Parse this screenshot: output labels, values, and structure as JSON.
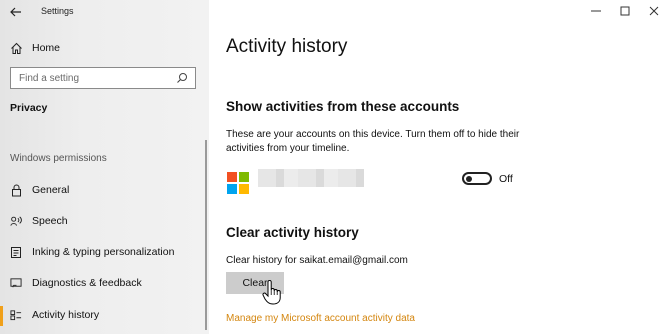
{
  "window": {
    "app_title": "Settings",
    "controls": {
      "minimize": "—",
      "maximize": "☐",
      "close": "✕"
    }
  },
  "sidebar": {
    "home_label": "Home",
    "search": {
      "placeholder": "Find a setting",
      "value": ""
    },
    "section_header": "Privacy",
    "group_label": "Windows permissions",
    "items": [
      {
        "label": "General",
        "icon": "lock-icon"
      },
      {
        "label": "Speech",
        "icon": "speech-icon"
      },
      {
        "label": "Inking & typing personalization",
        "icon": "inking-icon"
      },
      {
        "label": "Diagnostics & feedback",
        "icon": "diagnostics-icon"
      },
      {
        "label": "Activity history",
        "icon": "activity-icon",
        "selected": true
      }
    ],
    "accent_color": "#f0a01a"
  },
  "main": {
    "title": "Activity history",
    "accounts_heading": "Show activities from these accounts",
    "accounts_desc": "These are your accounts on this device. Turn them off to hide their activities from your timeline.",
    "account": {
      "logo_colors": [
        "#f25022",
        "#7fba00",
        "#00a4ef",
        "#ffb900"
      ],
      "toggle_state": "Off"
    },
    "clear_heading": "Clear activity history",
    "clear_for": "Clear history for saikat.email@gmail.com",
    "clear_button": "Clear",
    "manage_link": "Manage my Microsoft account activity data",
    "link_color": "#d4860f"
  }
}
